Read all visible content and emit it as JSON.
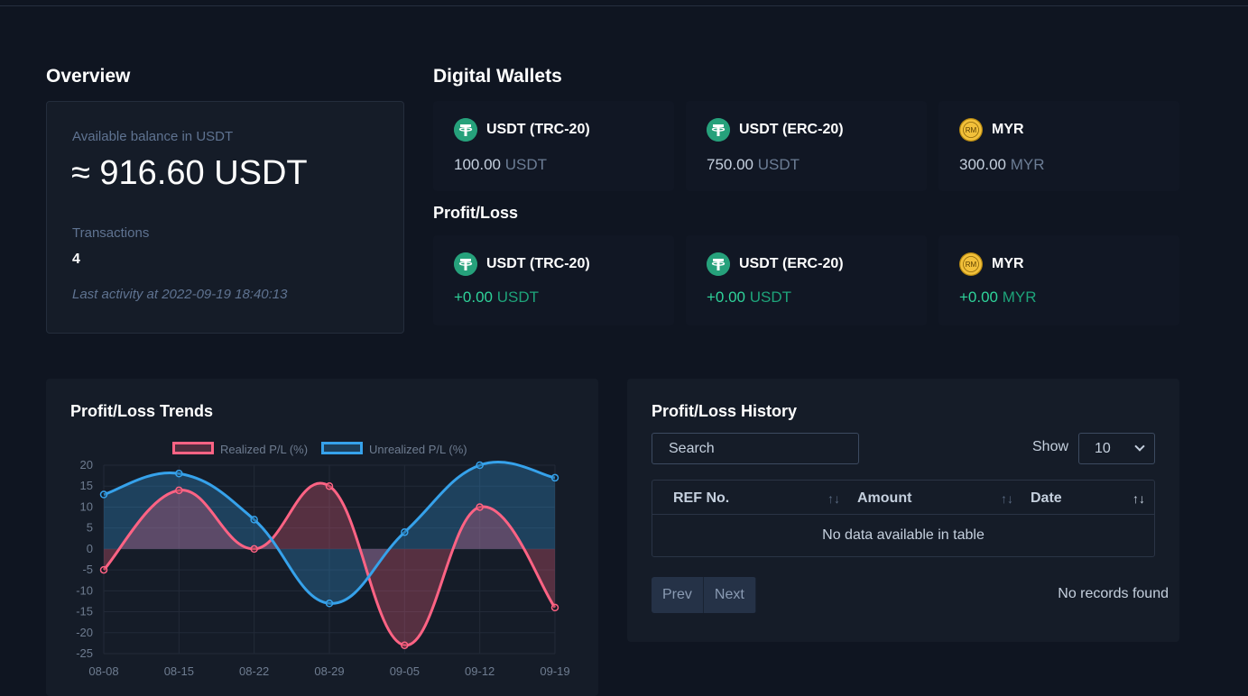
{
  "overview": {
    "title": "Overview",
    "balance_label": "Available balance in USDT",
    "balance_value": "≈ 916.60 USDT",
    "transactions_label": "Transactions",
    "transactions_value": "4",
    "last_activity": "Last activity at 2022-09-19 18:40:13"
  },
  "wallets": {
    "title": "Digital Wallets",
    "items": [
      {
        "name": "USDT (TRC-20)",
        "amount": "100.00",
        "unit": "USDT",
        "icon": "tether-icon"
      },
      {
        "name": "USDT (ERC-20)",
        "amount": "750.00",
        "unit": "USDT",
        "icon": "tether-icon"
      },
      {
        "name": "MYR",
        "amount": "300.00",
        "unit": "MYR",
        "icon": "ringgit-icon",
        "icon_text": "RM"
      }
    ]
  },
  "profit_loss": {
    "title": "Profit/Loss",
    "items": [
      {
        "name": "USDT (TRC-20)",
        "amount": "+0.00",
        "unit": "USDT"
      },
      {
        "name": "USDT (ERC-20)",
        "amount": "+0.00",
        "unit": "USDT"
      },
      {
        "name": "MYR",
        "amount": "+0.00",
        "unit": "MYR",
        "icon_text": "RM"
      }
    ]
  },
  "trends": {
    "title": "Profit/Loss Trends"
  },
  "chart_data": {
    "type": "line",
    "title": "",
    "x": [
      "08-08",
      "08-15",
      "08-22",
      "08-29",
      "09-05",
      "09-12",
      "09-19"
    ],
    "series": [
      {
        "name": "Realized P/L (%)",
        "values": [
          -5,
          14,
          0,
          15,
          -23,
          10,
          -14
        ],
        "color": "#ff6384"
      },
      {
        "name": "Unrealized P/L (%)",
        "values": [
          13,
          18,
          7,
          -13,
          4,
          20,
          17
        ],
        "color": "#36a2eb"
      }
    ],
    "yticks": [
      20,
      15,
      10,
      5,
      0,
      -5,
      -10,
      -15,
      -20,
      -25
    ],
    "ylim": [
      -25,
      20
    ],
    "grid": true,
    "legend": "top-center",
    "fill": true
  },
  "history": {
    "title": "Profit/Loss History",
    "search_placeholder": "Search",
    "show_label": "Show",
    "show_value": "10",
    "columns": [
      "REF No.",
      "Amount",
      "Date"
    ],
    "empty": "No data available in table",
    "prev": "Prev",
    "next": "Next",
    "no_records": "No records found"
  },
  "colors": {
    "background": "#0f1521",
    "card": "#151c28",
    "positive": "#2fd39a",
    "tether": "#26a17b",
    "ringgit": "#f2c03a"
  }
}
